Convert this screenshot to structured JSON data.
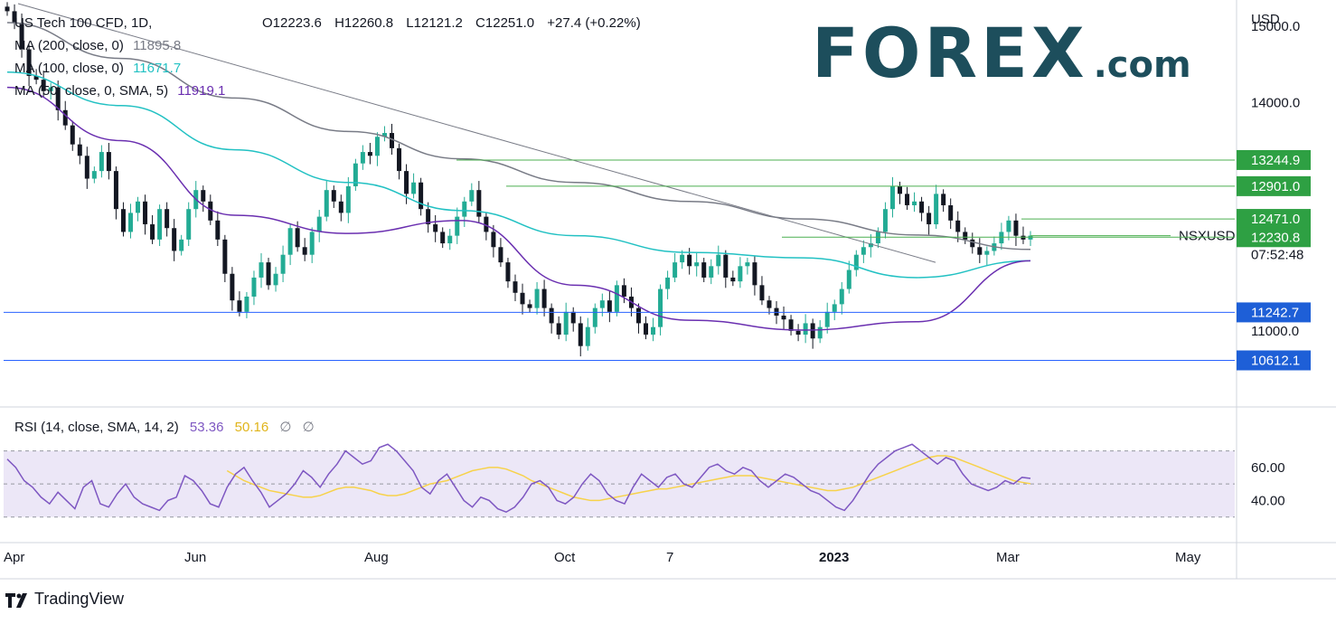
{
  "header": {
    "symbol_title": "US Tech 100 CFD, 1D,",
    "open": "O12223.6",
    "high": "H12260.8",
    "low": "L12121.2",
    "close": "C12251.0",
    "change": "+27.4 (+0.22%)"
  },
  "indicators": [
    {
      "label": "MA (200, close, 0)",
      "value": "11895.8",
      "color": "#787b86"
    },
    {
      "label": "MA (100, close, 0)",
      "value": "11671.7",
      "color": "#22c1c3"
    },
    {
      "label": "MA (50, close, 0, SMA, 5)",
      "value": "11919.1",
      "color": "#6a2fb0"
    }
  ],
  "rsi_legend": {
    "label": "RSI (14, close, SMA, 14, 2)",
    "rsi_value": "53.36",
    "sma_value": "50.16",
    "extra1": "∅",
    "extra2": "∅",
    "rsi_color": "#7e57c2",
    "sma_color": "#f7d24a"
  },
  "logo": {
    "main": "FOREX",
    "suffix": ".com"
  },
  "footer": {
    "brand": "TradingView"
  },
  "colors": {
    "up": "#22ab94",
    "down": "#131722",
    "level_line_green": "#4caf50",
    "level_line_blue": "#2962ff",
    "badge_green": "#2ea043",
    "badge_blue": "#1e5fd7",
    "rsi_band": "#ece7f7"
  },
  "chart_data": [
    {
      "type": "candlestick",
      "symbol": "NSXUSD",
      "currency": "USD",
      "x_axis_labels": [
        "Apr",
        "Jun",
        "Aug",
        "Oct",
        "7",
        "2023",
        "Mar",
        "May"
      ],
      "y_ticks": [
        "15000.0",
        "14000.0",
        "11000.0"
      ],
      "ylim": [
        10000,
        15300
      ],
      "price_labels": [
        {
          "value": 13244.9,
          "text": "13244.9",
          "style": "green"
        },
        {
          "value": 12901.0,
          "text": "12901.0",
          "style": "green"
        },
        {
          "value": 12471.0,
          "text": "12471.0",
          "style": "green"
        },
        {
          "value": 12251.0,
          "text": "12251.0",
          "style": "plain"
        },
        {
          "value": 12230.8,
          "text": "12230.8",
          "style": "green"
        },
        {
          "value": 11242.7,
          "text": "11242.7",
          "style": "blue"
        },
        {
          "value": 10612.1,
          "text": "10612.1",
          "style": "blue"
        }
      ],
      "last_price_tag": "NSXUSD",
      "countdown": "07:52:48",
      "support_resistance": [
        13244.9,
        12901.0,
        12471.0,
        12230.8,
        11242.7,
        10612.1
      ],
      "close_series": [
        15200,
        15050,
        14700,
        14350,
        14300,
        14150,
        14200,
        13900,
        13700,
        13450,
        13300,
        13000,
        13100,
        13350,
        13100,
        12600,
        12300,
        12550,
        12700,
        12400,
        12200,
        12600,
        12350,
        12050,
        12200,
        12600,
        12850,
        12700,
        12450,
        12200,
        11750,
        11400,
        11250,
        11450,
        11700,
        11900,
        11600,
        11750,
        12000,
        12350,
        12100,
        12000,
        12300,
        12500,
        12850,
        12700,
        12550,
        12900,
        13200,
        13350,
        13300,
        13550,
        13600,
        13400,
        13100,
        12800,
        12950,
        12600,
        12400,
        12300,
        12150,
        12250,
        12500,
        12700,
        12850,
        12500,
        12300,
        12100,
        11900,
        11650,
        11500,
        11350,
        11300,
        11550,
        11300,
        11100,
        10950,
        11250,
        11100,
        10800,
        11050,
        11300,
        11400,
        11250,
        11600,
        11450,
        11300,
        11100,
        10950,
        11050,
        11550,
        11700,
        11900,
        12000,
        11850,
        11900,
        11700,
        11850,
        12000,
        11700,
        11650,
        11850,
        11900,
        11600,
        11400,
        11300,
        11200,
        11150,
        11000,
        10950,
        11100,
        10900,
        11050,
        11250,
        11350,
        11550,
        11800,
        12000,
        12100,
        12150,
        12300,
        12600,
        12900,
        12800,
        12650,
        12700,
        12550,
        12400,
        12800,
        12650,
        12450,
        12300,
        12200,
        12100,
        12000,
        12050,
        12150,
        12300,
        12450,
        12250,
        12200,
        12251
      ],
      "ma200": [
        15050,
        14580,
        14060,
        13620,
        13260,
        12950,
        12700,
        12470,
        12260,
        12070
      ],
      "ma100": [
        14400,
        13960,
        13380,
        12950,
        12580,
        12250,
        12030,
        11960,
        11700,
        11920
      ],
      "ma50": [
        14200,
        13500,
        12520,
        12280,
        12450,
        11600,
        11140,
        11010,
        11120,
        11920
      ]
    },
    {
      "type": "line",
      "name": "RSI",
      "y_ticks": [
        "60.00",
        "40.00"
      ],
      "band": [
        30,
        70
      ],
      "rsi": [
        65,
        60,
        52,
        48,
        42,
        38,
        45,
        40,
        35,
        48,
        52,
        38,
        36,
        44,
        50,
        42,
        38,
        36,
        34,
        40,
        42,
        55,
        52,
        46,
        38,
        36,
        48,
        56,
        60,
        52,
        45,
        36,
        40,
        44,
        50,
        58,
        54,
        48,
        56,
        62,
        70,
        66,
        62,
        64,
        72,
        74,
        70,
        64,
        58,
        48,
        44,
        52,
        56,
        48,
        40,
        36,
        42,
        40,
        35,
        33,
        36,
        42,
        50,
        52,
        48,
        40,
        38,
        42,
        50,
        56,
        52,
        44,
        40,
        38,
        48,
        56,
        52,
        48,
        54,
        56,
        50,
        48,
        54,
        60,
        62,
        58,
        56,
        60,
        58,
        52,
        48,
        52,
        56,
        54,
        50,
        46,
        44,
        40,
        36,
        34,
        40,
        48,
        56,
        62,
        66,
        70,
        72,
        74,
        70,
        66,
        62,
        66,
        64,
        56,
        50,
        48,
        46,
        48,
        52,
        50,
        54,
        53.36
      ],
      "rsi_sma": [
        58,
        55,
        52,
        50,
        48,
        46,
        45,
        44,
        43,
        42,
        42,
        43,
        45,
        47,
        48,
        48,
        47,
        46,
        44,
        43,
        43,
        44,
        46,
        48,
        50,
        51,
        52,
        54,
        56,
        58,
        59,
        60,
        60,
        59,
        57,
        55,
        52,
        50,
        48,
        46,
        44,
        42,
        41,
        40,
        40,
        41,
        42,
        43,
        44,
        45,
        46,
        47,
        47,
        48,
        49,
        50,
        51,
        52,
        53,
        54,
        55,
        55,
        55,
        54,
        53,
        52,
        51,
        50,
        49,
        48,
        47,
        46,
        46,
        47,
        48,
        50,
        52,
        54,
        56,
        58,
        60,
        62,
        64,
        66,
        67,
        67,
        66,
        64,
        62,
        60,
        58,
        56,
        54,
        52,
        51,
        50.16
      ]
    }
  ]
}
